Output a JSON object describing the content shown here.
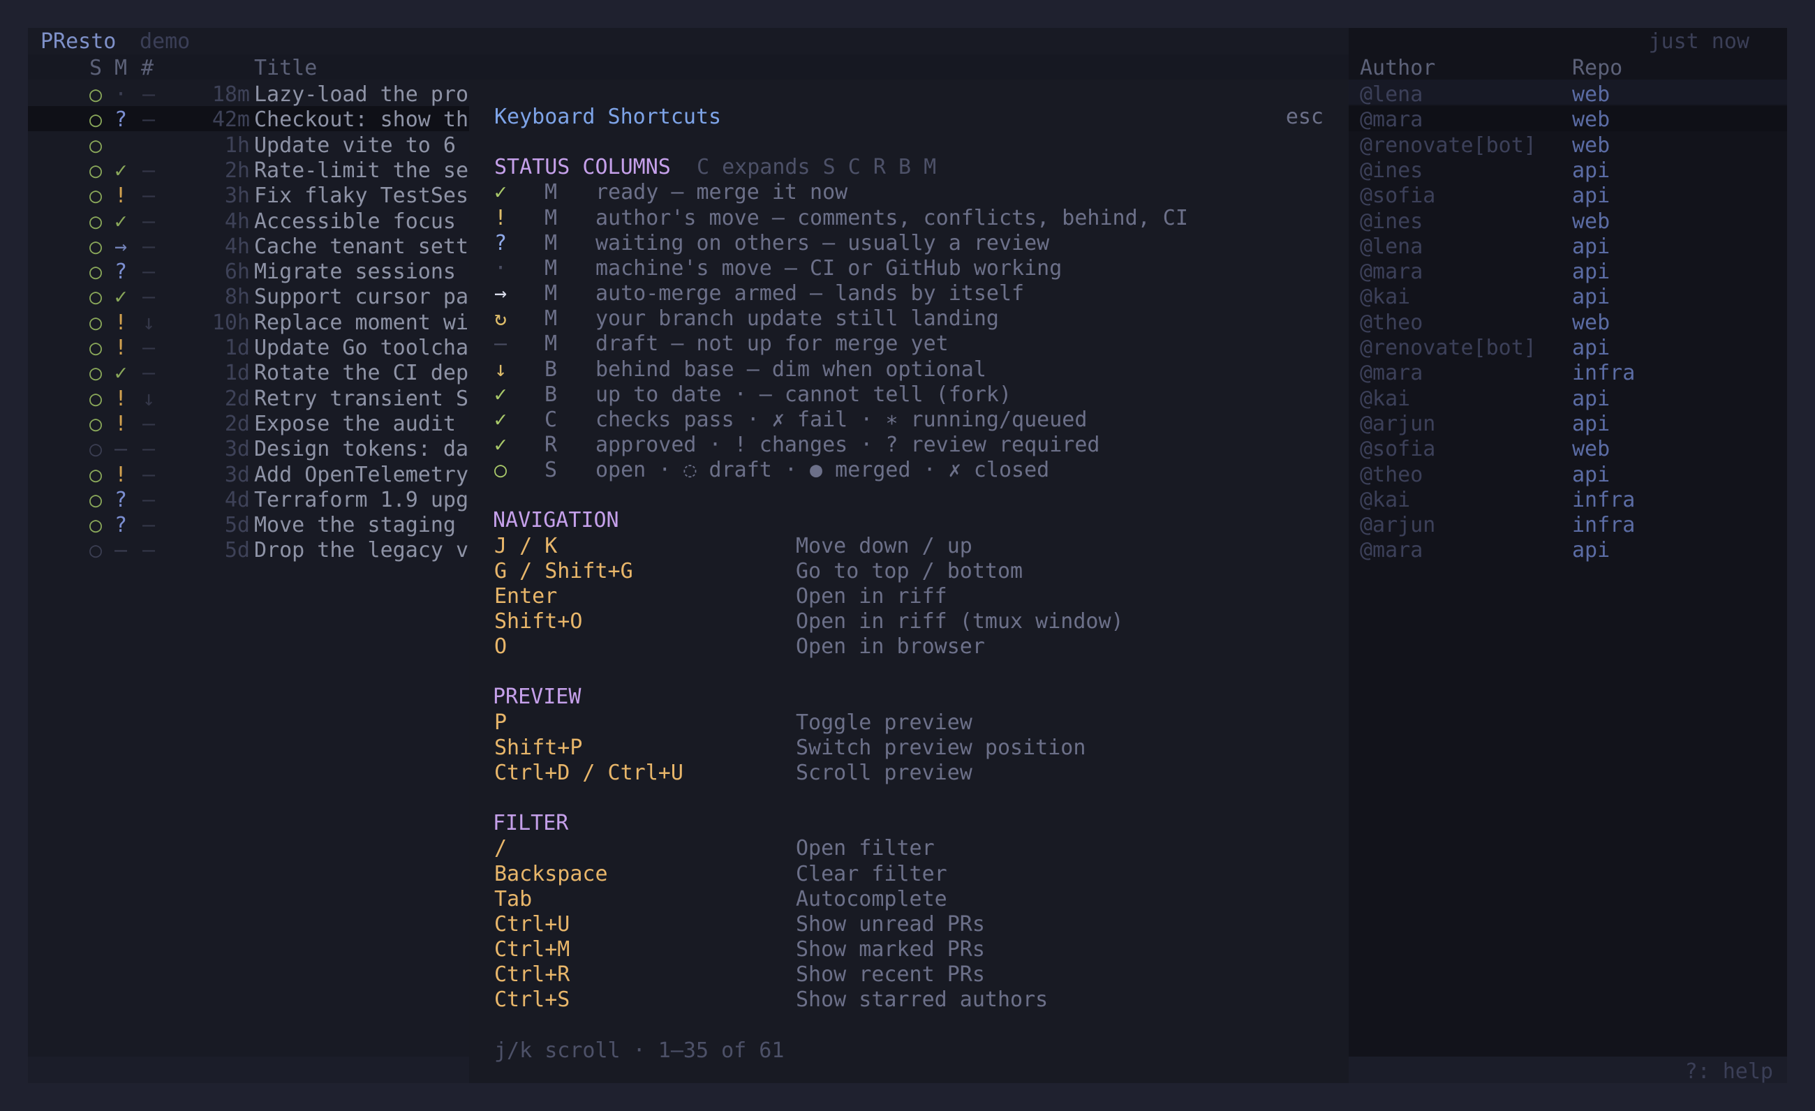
{
  "app": {
    "name": "PResto",
    "mode": "demo",
    "updated": "just now"
  },
  "columns": {
    "s": "S",
    "m": "M",
    "n": "#",
    "title": "Title",
    "author": "Author",
    "repo": "Repo"
  },
  "rows": [
    {
      "s": "○",
      "m": "·",
      "mcls": "m-dim",
      "n": "–",
      "age": "18m",
      "title": "Lazy-load the pro",
      "author": "@lena",
      "repo": "web"
    },
    {
      "s": "○",
      "m": "?",
      "mcls": "m-q",
      "n": "–",
      "age": "42m",
      "title": "Checkout: show th",
      "author": "@mara",
      "repo": "web"
    },
    {
      "s": "○",
      "m": "",
      "mcls": "m-dim",
      "n": "",
      "age": "1h",
      "title": "Update vite to 6",
      "author": "@renovate[bot]",
      "repo": "web"
    },
    {
      "s": "○",
      "m": "✓",
      "mcls": "m-ok",
      "n": "–",
      "age": "2h",
      "title": "Rate-limit the se",
      "author": "@ines",
      "repo": "api"
    },
    {
      "s": "○",
      "m": "!",
      "mcls": "m-warn",
      "n": "–",
      "age": "3h",
      "title": "Fix flaky TestSes",
      "author": "@sofia",
      "repo": "api"
    },
    {
      "s": "○",
      "m": "✓",
      "mcls": "m-ok",
      "n": "–",
      "age": "4h",
      "title": "Accessible focus",
      "author": "@ines",
      "repo": "web"
    },
    {
      "s": "○",
      "m": "→",
      "mcls": "m-arrow",
      "n": "–",
      "age": "4h",
      "title": "Cache tenant sett",
      "author": "@lena",
      "repo": "api"
    },
    {
      "s": "○",
      "m": "?",
      "mcls": "m-q",
      "n": "–",
      "age": "6h",
      "title": "Migrate sessions",
      "author": "@mara",
      "repo": "api"
    },
    {
      "s": "○",
      "m": "✓",
      "mcls": "m-ok",
      "n": "–",
      "age": "8h",
      "title": "Support cursor pa",
      "author": "@kai",
      "repo": "api"
    },
    {
      "s": "○",
      "m": "!",
      "mcls": "m-warn",
      "n": "↓",
      "age": "10h",
      "title": "Replace moment wi",
      "author": "@theo",
      "repo": "web"
    },
    {
      "s": "○",
      "m": "!",
      "mcls": "m-warn",
      "n": "–",
      "age": "1d",
      "title": "Update Go toolcha",
      "author": "@renovate[bot]",
      "repo": "api"
    },
    {
      "s": "○",
      "m": "✓",
      "mcls": "m-ok",
      "n": "–",
      "age": "1d",
      "title": "Rotate the CI dep",
      "author": "@mara",
      "repo": "infra"
    },
    {
      "s": "○",
      "m": "!",
      "mcls": "m-warn",
      "n": "↓",
      "age": "2d",
      "title": "Retry transient S",
      "author": "@kai",
      "repo": "api"
    },
    {
      "s": "○",
      "m": "!",
      "mcls": "m-warn",
      "n": "–",
      "age": "2d",
      "title": "Expose the audit",
      "author": "@arjun",
      "repo": "api"
    },
    {
      "s": "○",
      "m": "–",
      "mcls": "m-dim",
      "n": "–",
      "age": "3d",
      "title": "Design tokens: da",
      "author": "@sofia",
      "repo": "web",
      "sdim": true
    },
    {
      "s": "○",
      "m": "!",
      "mcls": "m-warn",
      "n": "–",
      "age": "3d",
      "title": "Add OpenTelemetry",
      "author": "@theo",
      "repo": "api"
    },
    {
      "s": "○",
      "m": "?",
      "mcls": "m-q",
      "n": "–",
      "age": "4d",
      "title": "Terraform 1.9 upg",
      "author": "@kai",
      "repo": "infra"
    },
    {
      "s": "○",
      "m": "?",
      "mcls": "m-q",
      "n": "–",
      "age": "5d",
      "title": "Move the staging",
      "author": "@arjun",
      "repo": "infra"
    },
    {
      "s": "○",
      "m": "–",
      "mcls": "m-dim",
      "n": "–",
      "age": "5d",
      "title": "Drop the legacy v",
      "author": "@mara",
      "repo": "api",
      "sdim": true
    }
  ],
  "overlay": {
    "title": "Keyboard Shortcuts",
    "close": "esc",
    "status": {
      "heading": "STATUS COLUMNS",
      "hint": "C expands S C R B M",
      "items": [
        {
          "sym": "✓",
          "cls": "ok",
          "col": "M",
          "desc": "ready — merge it now"
        },
        {
          "sym": "!",
          "cls": "",
          "col": "M",
          "desc": "author's move — comments, conflicts, behind, CI"
        },
        {
          "sym": "?",
          "cls": "q",
          "col": "M",
          "desc": "waiting on others — usually a review"
        },
        {
          "sym": "·",
          "cls": "dim",
          "col": "M",
          "desc": "machine's move — CI or GitHub working"
        },
        {
          "sym": "→",
          "cls": "arrow",
          "col": "M",
          "desc": "auto-merge armed — lands by itself"
        },
        {
          "sym": "↻",
          "cls": "",
          "col": "M",
          "desc": "your branch update still landing"
        },
        {
          "sym": "–",
          "cls": "dim",
          "col": "M",
          "desc": "draft — not up for merge yet"
        },
        {
          "sym": "↓",
          "cls": "",
          "col": "B",
          "desc": "behind base — dim when optional"
        },
        {
          "sym": "✓",
          "cls": "ok",
          "col": "B",
          "desc": "up to date · – cannot tell (fork)"
        },
        {
          "sym": "✓",
          "cls": "ok",
          "col": "C",
          "desc": "checks pass · ✗ fail · ∗ running/queued"
        },
        {
          "sym": "✓",
          "cls": "ok",
          "col": "R",
          "desc": "approved · ! changes · ? review required"
        },
        {
          "sym": "○",
          "cls": "ok",
          "col": "S",
          "desc": "open · ◌ draft · ● merged · ✗ closed"
        }
      ]
    },
    "sections": [
      {
        "heading": "NAVIGATION",
        "items": [
          {
            "key": "J / K",
            "action": "Move down / up"
          },
          {
            "key": "G / Shift+G",
            "action": "Go to top / bottom"
          },
          {
            "key": "Enter",
            "action": "Open in riff"
          },
          {
            "key": "Shift+O",
            "action": "Open in riff (tmux window)"
          },
          {
            "key": "O",
            "action": "Open in browser"
          }
        ]
      },
      {
        "heading": "PREVIEW",
        "items": [
          {
            "key": "P",
            "action": "Toggle preview"
          },
          {
            "key": "Shift+P",
            "action": "Switch preview position"
          },
          {
            "key": "Ctrl+D / Ctrl+U",
            "action": "Scroll preview"
          }
        ]
      },
      {
        "heading": "FILTER",
        "items": [
          {
            "key": "/",
            "action": "Open filter"
          },
          {
            "key": "Backspace",
            "action": "Clear filter"
          },
          {
            "key": "Tab",
            "action": "Autocomplete"
          },
          {
            "key": "Ctrl+U",
            "action": "Show unread PRs"
          },
          {
            "key": "Ctrl+M",
            "action": "Show marked PRs"
          },
          {
            "key": "Ctrl+R",
            "action": "Show recent PRs"
          },
          {
            "key": "Ctrl+S",
            "action": "Show starred authors"
          }
        ]
      }
    ],
    "footer": "j/k scroll · 1–35 of 61"
  },
  "footer": {
    "help": "?: help"
  },
  "colors": {
    "background": "#181a24",
    "accent": "#7ea4e8",
    "section": "#c5a0ea",
    "key": "#e8b66a",
    "ok": "#a9c96a"
  }
}
